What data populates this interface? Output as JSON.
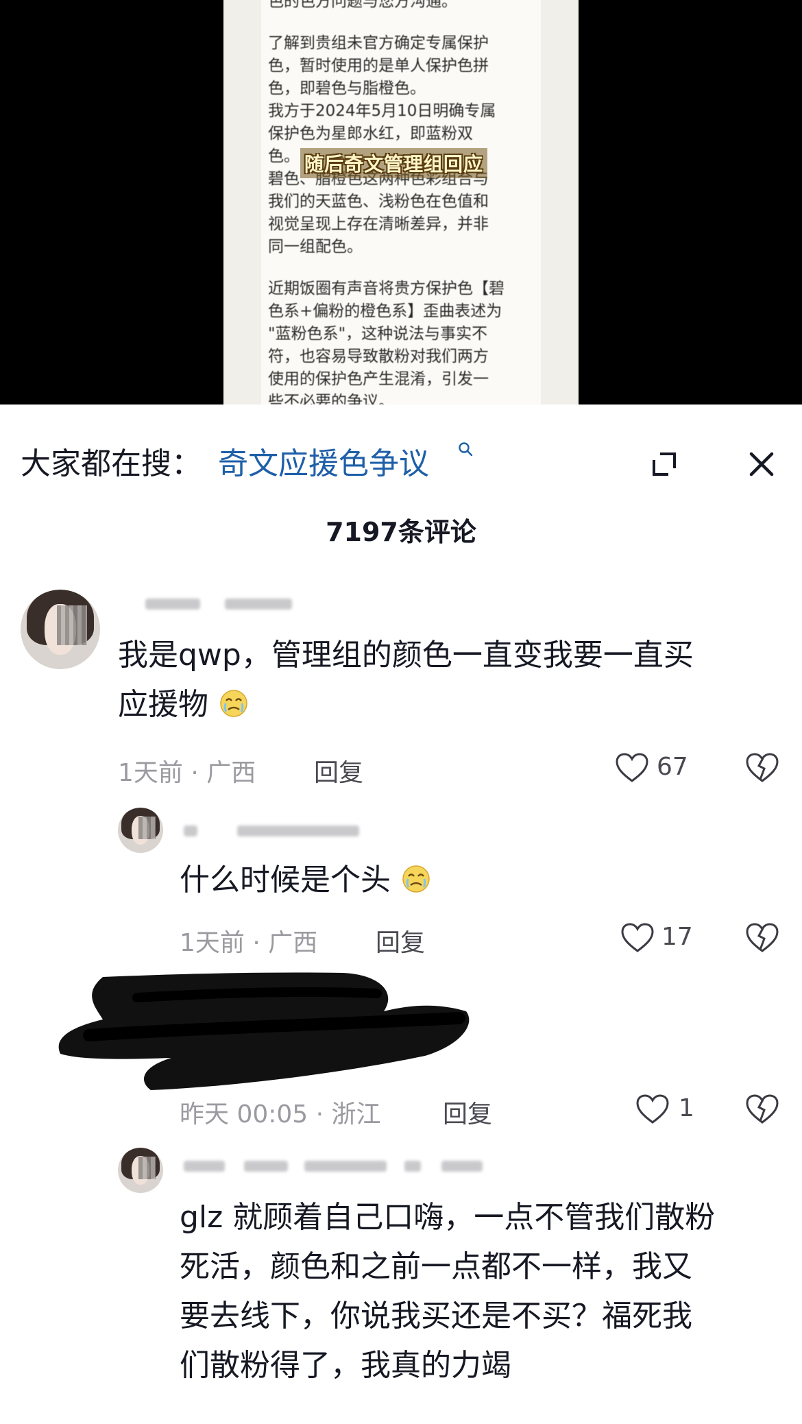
{
  "video": {
    "doc_top_line": "色的色方问题与您方沟通。",
    "doc_paragraph_1": "了解到贵组未官方确定专属保护\n色，暂时使用的是单人保护色拼\n色，即碧色与脂橙色。\n我方于2024年5月10日明确专属\n保护色为星郎水红，即蓝粉双\n色。\n碧色、脂橙色这两种色彩组合与\n我们的天蓝色、浅粉色在色值和\n视觉呈现上存在清晰差异，并非\n同一组配色。",
    "doc_paragraph_2": "近期饭圈有声音将贵方保护色【碧\n色系+偏粉的橙色系】歪曲表述为\n\"蓝粉色系\"，这种说法与事实不\n符，也容易导致散粉对我们两方\n使用的保护色产生混淆，引发一\n些不必要的争议。",
    "caption": "随后奇文管理组回应"
  },
  "search": {
    "prefix": "大家都在搜：",
    "term": "奇文应援色争议"
  },
  "comments_header": {
    "count_label": "7197条评论"
  },
  "comments": [
    {
      "text_line1": "我是qwp，管理组的颜色一直变我要一直买",
      "text_line2": "应援物",
      "meta": "1天前 · 广西",
      "reply": "回复",
      "likes": "67"
    },
    {
      "text": "什么时候是个头",
      "meta": "1天前 · 广西",
      "reply": "回复",
      "likes": "17"
    },
    {
      "meta": "昨天 00:05 · 浙江",
      "reply": "回复",
      "likes": "1"
    },
    {
      "text_line1": "glz 就顾着自己口嗨，一点不管我们散粉",
      "text_line2": "死活，颜色和之前一点都不一样，我又",
      "text_line3": "要去线下，你说我买还是不买？福死我",
      "text_line4": "们散粉得了，我真的力竭"
    }
  ],
  "colors": {
    "search_term": "#1d5fa8",
    "meta_gray": "#9a9aa0",
    "text_dark": "#161823"
  },
  "icons": [
    "search-icon",
    "expand-icon",
    "close-icon",
    "heart-icon",
    "broken-heart-icon",
    "emoji-icon"
  ]
}
